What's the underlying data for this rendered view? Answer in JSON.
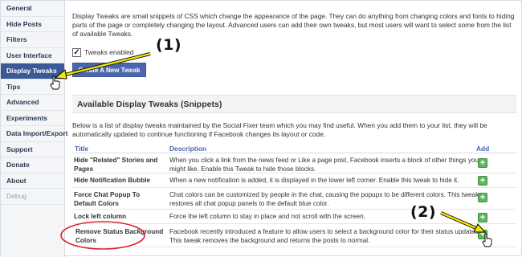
{
  "sidebar": {
    "items": [
      {
        "label": "General"
      },
      {
        "label": "Hide Posts"
      },
      {
        "label": "Filters"
      },
      {
        "label": "User Interface"
      },
      {
        "label": "Display Tweaks",
        "active": true
      },
      {
        "label": "Tips"
      },
      {
        "label": "Advanced"
      },
      {
        "label": "Experiments"
      },
      {
        "label": "Data Import/Export"
      },
      {
        "label": "Support"
      },
      {
        "label": "Donate"
      },
      {
        "label": "About"
      },
      {
        "label": "Debug",
        "muted": true
      }
    ]
  },
  "main": {
    "intro": "Display Tweaks are small snippets of CSS which change the appearance of the page. They can do anything from changing colors and fonts to hiding parts of the page or completely changing the layout. Advanced users can add their own tweaks, but most users will want to select some from the list of available Tweaks.",
    "enable_label": "Tweaks enabled",
    "enable_checked": true,
    "create_button": "Create A New Tweak",
    "section_title": "Available Display Tweaks (Snippets)",
    "list_intro": "Below is a list of display tweaks maintained by the Social Fixer team which you may find useful. When you add them to your list, they will be automatically updated to continue functioning if Facebook changes its layout or code.",
    "columns": {
      "title": "Title",
      "description": "Description",
      "add": "Add"
    },
    "tweaks": [
      {
        "title": "Hide \"Related\" Stories and Pages",
        "description": "When you click a link from the news feed or Like a page post, Facebook inserts a block of other things you might like. Enable this Tweak to hide those blocks.",
        "add": "+"
      },
      {
        "title": "Hide Notification Bubble",
        "description": "When a new notification is added, it is displayed in the lower left corner. Enable this tweak to hide it.",
        "add": "+"
      },
      {
        "title": "Force Chat Popup To Default Colors",
        "description": "Chat colors can be customized by people in the chat, causing the popups to be different colors. This tweak restores all chat popup panels to the default blue color.",
        "add": "+"
      },
      {
        "title": "Lock left column",
        "description": "Force the left column to stay in place and not scroll with the screen.",
        "add": "+"
      },
      {
        "title": "Remove Status Background Colors",
        "description": "Facebook recently introduced a feature to allow users to select a background color for their status updates. This tweak removes the background and returns the posts to normal.",
        "add": "+"
      }
    ]
  },
  "annotations": {
    "callout_1": "(1)",
    "callout_2": "(2)",
    "colors": {
      "arrow": "#f2e600",
      "highlight": "#d9232a",
      "accent": "#3b5998",
      "add": "#5cb85c"
    }
  }
}
